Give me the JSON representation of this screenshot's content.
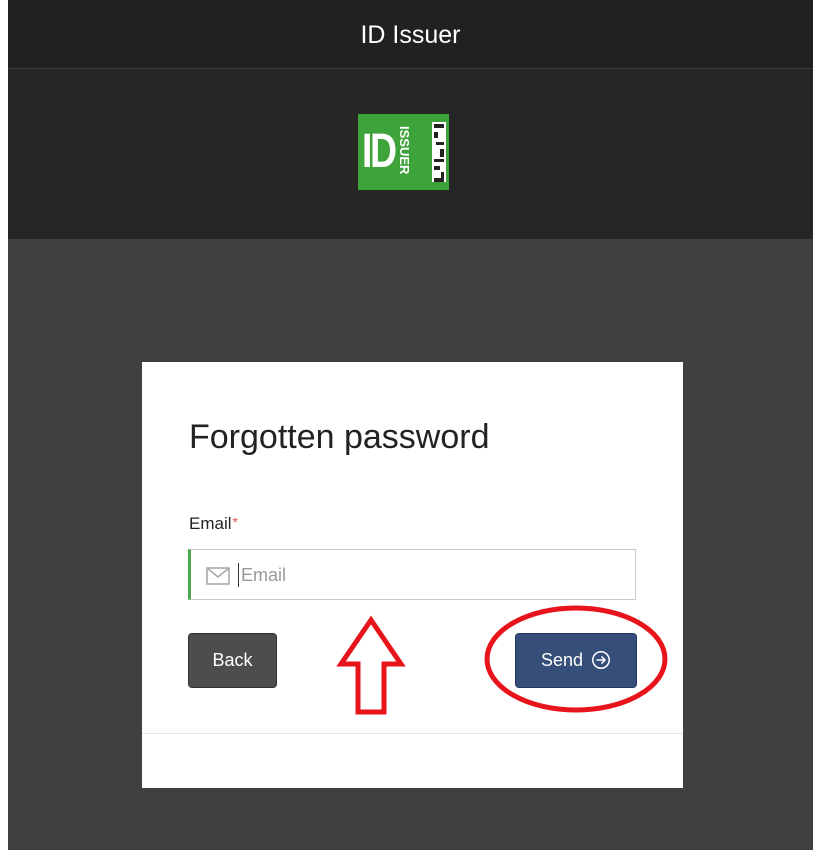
{
  "app": {
    "title": "ID Issuer"
  },
  "logo": {
    "id_text": "ID",
    "issuer_text": "ISSUER",
    "color": "#3ea33a"
  },
  "form": {
    "title": "Forgotten password",
    "email_label": "Email",
    "required_mark": "*",
    "email_placeholder": "Email",
    "email_value": "",
    "back_label": "Back",
    "send_label": "Send"
  },
  "annotations": {
    "arrow_color": "#e8141b",
    "circle_color": "#e8141b"
  },
  "icons": {
    "email": "mail-icon",
    "send": "arrow-circle-right-icon"
  }
}
